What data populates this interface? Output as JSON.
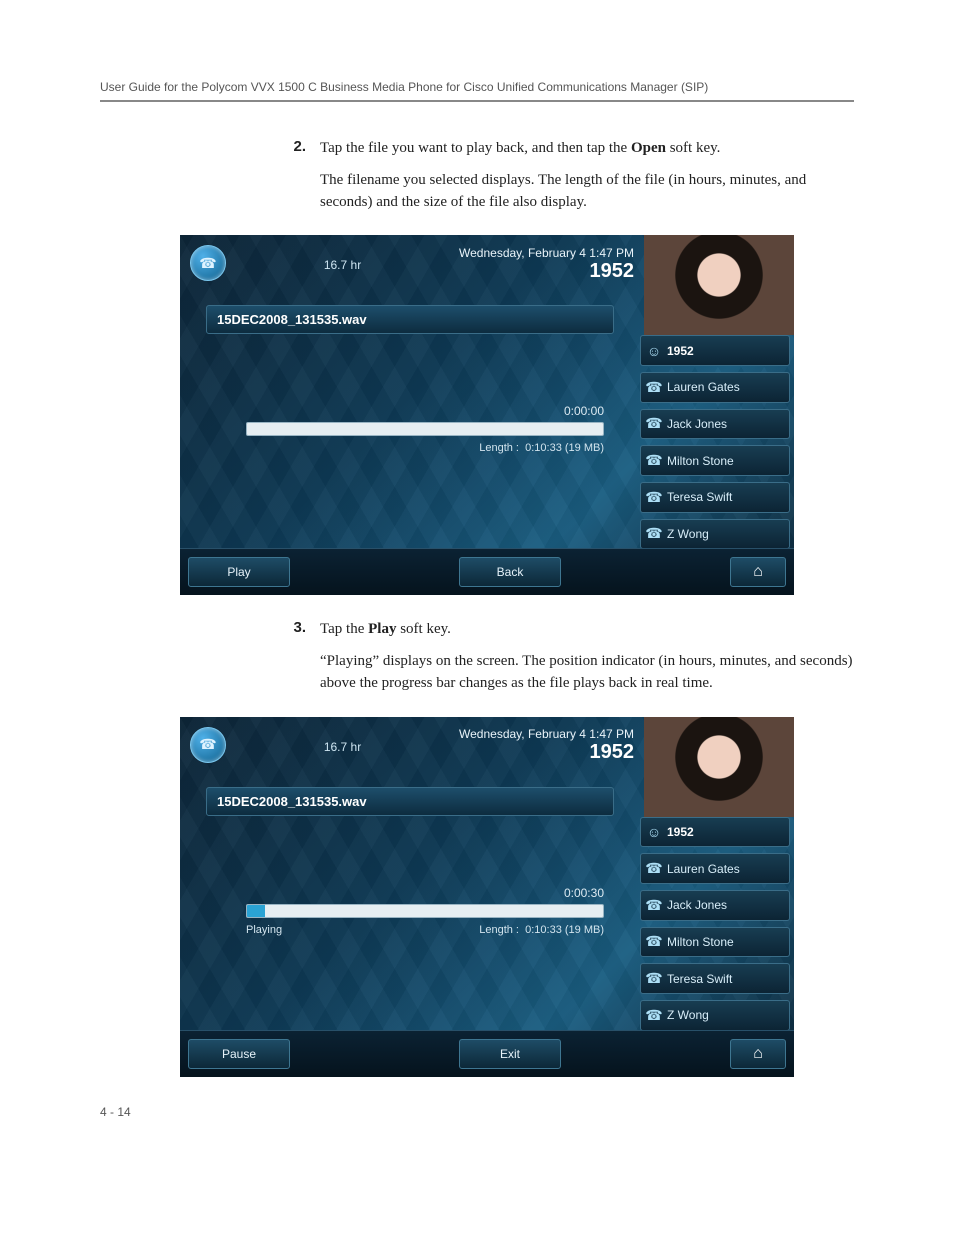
{
  "running_head": "User Guide for the Polycom VVX 1500 C Business Media Phone for Cisco Unified Communications Manager (SIP)",
  "page_number": "4 - 14",
  "steps": {
    "s2": {
      "num": "2.",
      "line1a": "Tap the file you want to play back, and then tap the ",
      "line1_bold": "Open",
      "line1b": " soft key.",
      "line2": "The filename you selected displays. The length of the file (in hours, minutes, and seconds) and the size of the file also display."
    },
    "s3": {
      "num": "3.",
      "line1a": "Tap the ",
      "line1_bold": "Play",
      "line1b": " soft key.",
      "line2": "“Playing” displays on the screen. The position indicator (in hours, minutes, and seconds) above the progress bar changes as the file plays back in real time."
    }
  },
  "screens": {
    "a": {
      "header_mid": "16.7 hr",
      "header_date": "Wednesday, February 4  1:47 PM",
      "header_ext": "1952",
      "filename": "15DEC2008_131535.wav",
      "elapsed": "0:00:00",
      "status": "",
      "length_label": "Length :",
      "length_value": "0:10:33 (19 MB)",
      "progress_pct": 0,
      "softkey_left": "Play",
      "softkey_mid": "Back"
    },
    "b": {
      "header_mid": "16.7 hr",
      "header_date": "Wednesday, February 4  1:47 PM",
      "header_ext": "1952",
      "filename": "15DEC2008_131535.wav",
      "elapsed": "0:00:30",
      "status": "Playing",
      "length_label": "Length :",
      "length_value": "0:10:33 (19 MB)",
      "progress_pct": 5,
      "softkey_left": "Pause",
      "softkey_mid": "Exit"
    },
    "side": {
      "i0": "1952",
      "i1": "Lauren Gates",
      "i2": "Jack Jones",
      "i3": "Milton Stone",
      "i4": "Teresa Swift",
      "i5": "Z Wong"
    }
  }
}
